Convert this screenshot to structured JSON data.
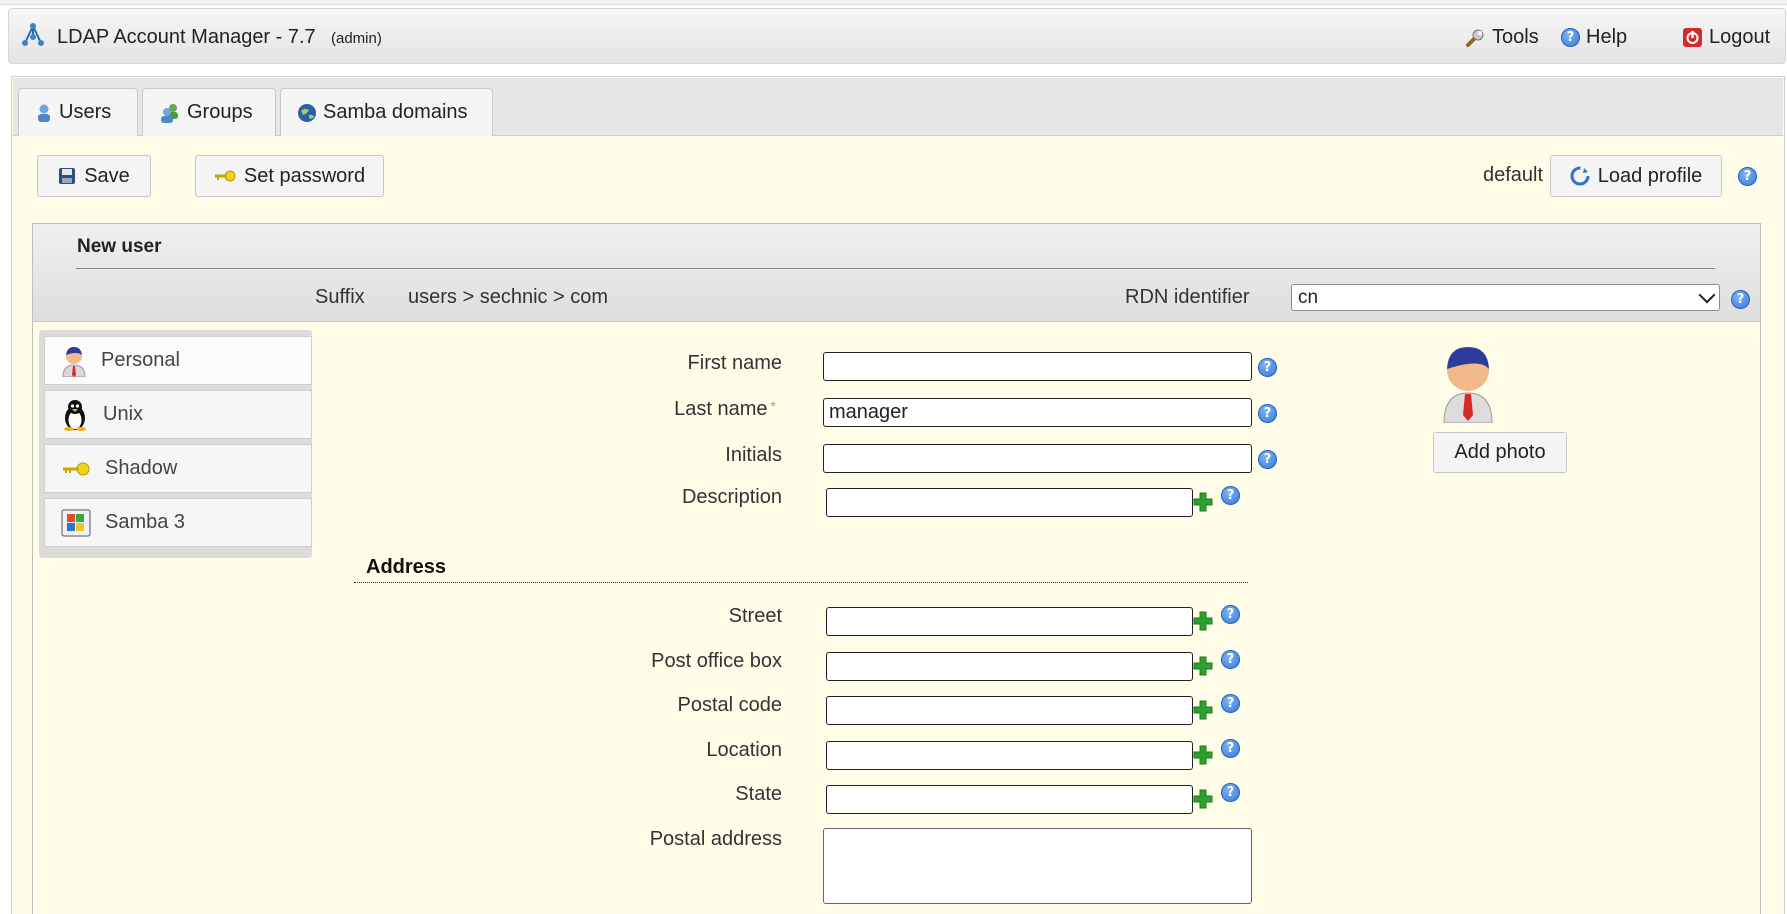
{
  "header": {
    "app_title": "LDAP Account Manager - 7.7",
    "user": "(admin)",
    "links": [
      {
        "label": "Tools",
        "icon": "wrench-icon"
      },
      {
        "label": "Help",
        "icon": "help-icon"
      },
      {
        "label": "Logout",
        "icon": "logout-icon"
      }
    ]
  },
  "tabs": [
    {
      "label": "Users",
      "icon": "user-icon"
    },
    {
      "label": "Groups",
      "icon": "group-icon"
    },
    {
      "label": "Samba domains",
      "icon": "globe-icon"
    }
  ],
  "toolbar": {
    "save_label": "Save",
    "set_password_label": "Set password",
    "profile_name": "default",
    "load_profile_label": "Load profile"
  },
  "account": {
    "title": "New user",
    "suffix_label": "Suffix",
    "suffix_value": "users > sechnic > com",
    "rdn_label": "RDN identifier",
    "rdn_value": "cn"
  },
  "modules": [
    {
      "label": "Personal",
      "icon": "personal-icon",
      "active": true
    },
    {
      "label": "Unix",
      "icon": "penguin-icon"
    },
    {
      "label": "Shadow",
      "icon": "key-icon"
    },
    {
      "label": "Samba 3",
      "icon": "windows-icon"
    }
  ],
  "form": {
    "first_name_label": "First name",
    "first_name_value": "",
    "last_name_label": "Last name",
    "last_name_value": "manager",
    "required_marker": "*",
    "initials_label": "Initials",
    "initials_value": "",
    "description_label": "Description",
    "description_value": "",
    "address_section": "Address",
    "street_label": "Street",
    "po_box_label": "Post office box",
    "postal_code_label": "Postal code",
    "location_label": "Location",
    "state_label": "State",
    "postal_address_label": "Postal address",
    "add_photo_label": "Add photo"
  },
  "colors": {
    "page_bg": "#fffde7",
    "help_blue": "#2f74d0",
    "required_orange": "#f08a24",
    "plus_green": "#2ea02e"
  }
}
